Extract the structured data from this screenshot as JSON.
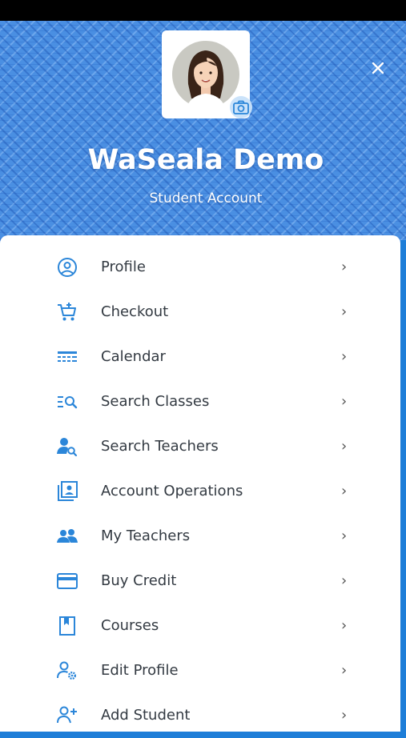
{
  "header": {
    "user_name": "WaSeala Demo",
    "account_type": "Student Account",
    "close_icon": "close-icon",
    "camera_icon": "camera-icon"
  },
  "colors": {
    "accent": "#2b86d9",
    "header_bg": "#4a8fe2",
    "text": "#333a42"
  },
  "menu": {
    "items": [
      {
        "label": "Profile",
        "icon": "user-circle-icon"
      },
      {
        "label": "Checkout",
        "icon": "cart-icon"
      },
      {
        "label": "Calendar",
        "icon": "calendar-icon"
      },
      {
        "label": "Search Classes",
        "icon": "search-list-icon"
      },
      {
        "label": "Search Teachers",
        "icon": "user-search-icon"
      },
      {
        "label": "Account Operations",
        "icon": "account-box-icon"
      },
      {
        "label": "My Teachers",
        "icon": "users-icon"
      },
      {
        "label": "Buy Credit",
        "icon": "credit-card-icon"
      },
      {
        "label": "Courses",
        "icon": "bookmark-book-icon"
      },
      {
        "label": "Edit Profile",
        "icon": "user-gear-icon"
      },
      {
        "label": "Add Student",
        "icon": "user-plus-icon"
      }
    ],
    "chevron": "›"
  }
}
